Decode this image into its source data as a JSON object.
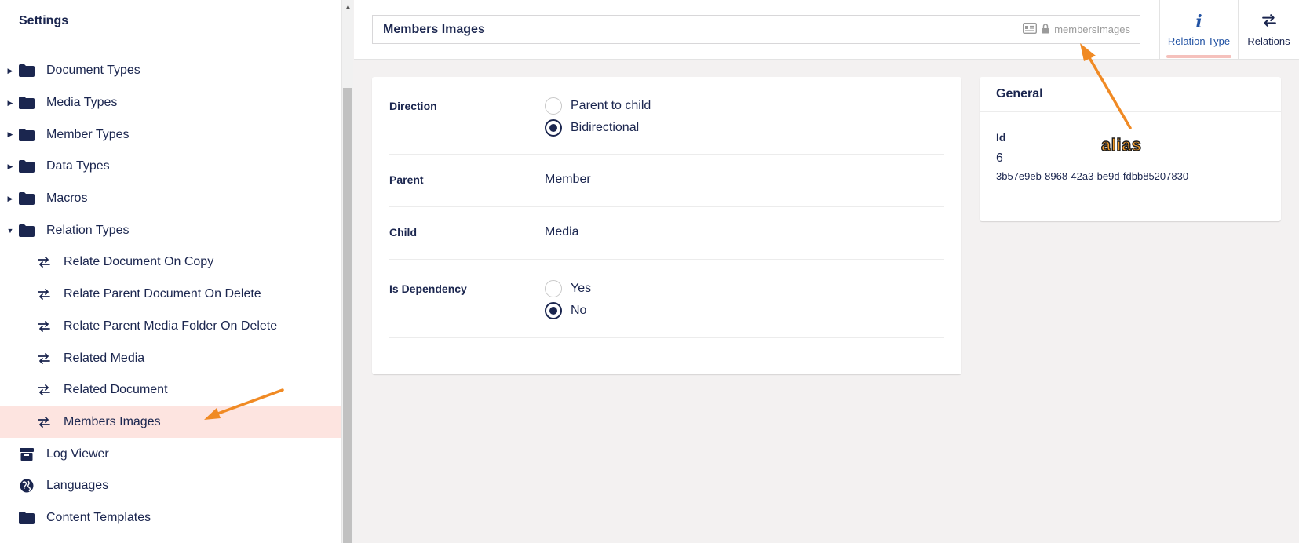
{
  "sidebar": {
    "title": "Settings",
    "items": [
      {
        "label": "Document Types",
        "icon": "folder-icon",
        "caret": "collapsed"
      },
      {
        "label": "Media Types",
        "icon": "folder-icon",
        "caret": "collapsed"
      },
      {
        "label": "Member Types",
        "icon": "folder-icon",
        "caret": "collapsed"
      },
      {
        "label": "Data Types",
        "icon": "folder-icon",
        "caret": "collapsed"
      },
      {
        "label": "Macros",
        "icon": "folder-icon",
        "caret": "collapsed"
      },
      {
        "label": "Relation Types",
        "icon": "folder-icon",
        "caret": "expanded"
      },
      {
        "label": "Relate Document On Copy",
        "icon": "arrows-swap-icon"
      },
      {
        "label": "Relate Parent Document On Delete",
        "icon": "arrows-swap-icon"
      },
      {
        "label": "Relate Parent Media Folder On Delete",
        "icon": "arrows-swap-icon"
      },
      {
        "label": "Related Media",
        "icon": "arrows-swap-icon"
      },
      {
        "label": "Related Document",
        "icon": "arrows-swap-icon"
      },
      {
        "label": "Members Images",
        "icon": "arrows-swap-icon",
        "selected": true
      },
      {
        "label": "Log Viewer",
        "icon": "archive-box-icon"
      },
      {
        "label": "Languages",
        "icon": "globe-icon"
      },
      {
        "label": "Content Templates",
        "icon": "folder-icon"
      }
    ]
  },
  "header": {
    "name_value": "Members Images",
    "alias": "membersImages",
    "tabs": [
      {
        "label": "Relation Type",
        "icon": "info-icon",
        "active": true
      },
      {
        "label": "Relations",
        "icon": "arrows-swap-icon"
      }
    ]
  },
  "main": {
    "direction": {
      "label": "Direction",
      "options": [
        {
          "label": "Parent to child",
          "checked": false
        },
        {
          "label": "Bidirectional",
          "checked": true
        }
      ]
    },
    "parent": {
      "label": "Parent",
      "value": "Member"
    },
    "child": {
      "label": "Child",
      "value": "Media"
    },
    "is_dependency": {
      "label": "Is Dependency",
      "options": [
        {
          "label": "Yes",
          "checked": false
        },
        {
          "label": "No",
          "checked": true
        }
      ]
    }
  },
  "general": {
    "title": "General",
    "id_label": "Id",
    "id_value": "6",
    "guid": "3b57e9eb-8968-42a3-be9d-fdbb85207830"
  },
  "annotations": {
    "alias_callout": "alias",
    "arrow_color": "#f08a24"
  },
  "colors": {
    "brand_dark": "#1b264f",
    "selected_bg": "#fde4e0",
    "active_tab_underline": "#f5c1bc"
  }
}
